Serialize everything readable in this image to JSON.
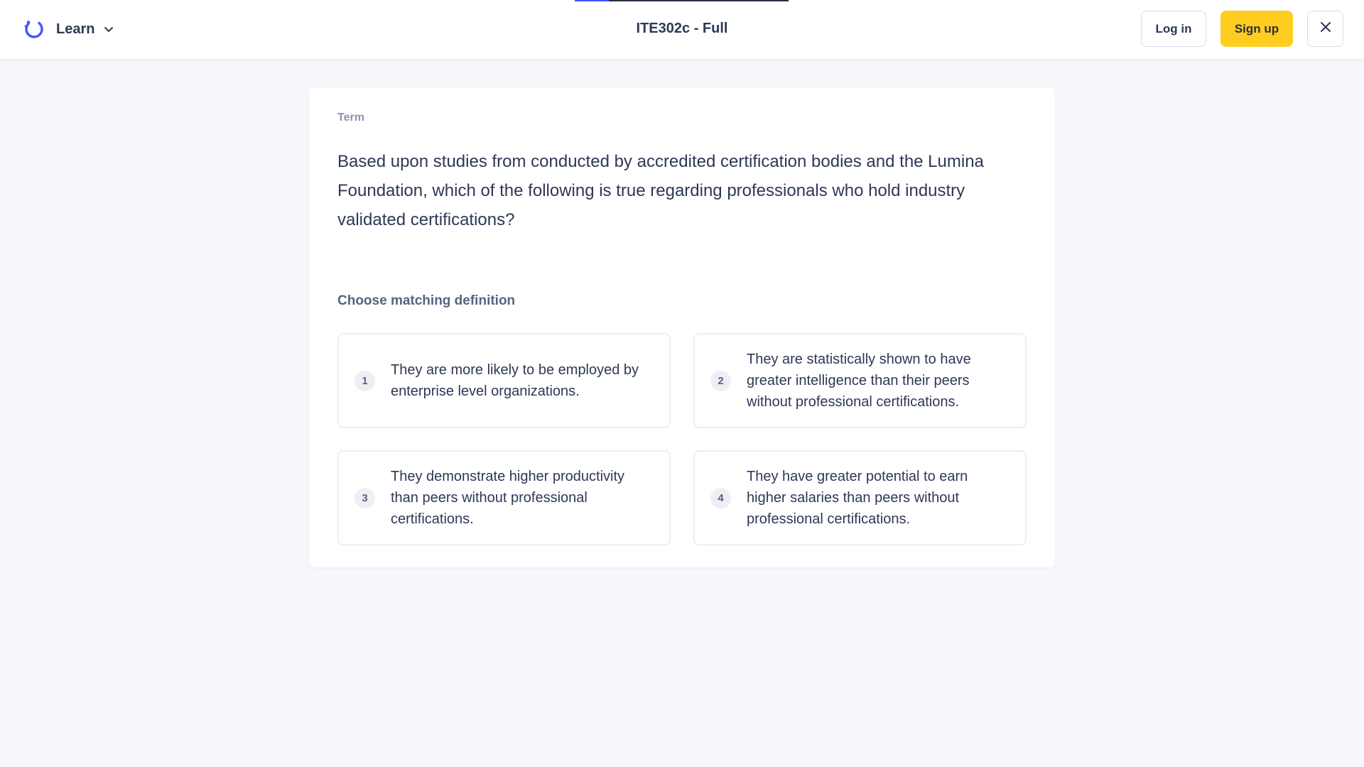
{
  "header": {
    "mode_label": "Learn",
    "set_title": "ITE302c - Full",
    "login_label": "Log in",
    "signup_label": "Sign up",
    "progress_fraction": 0.16,
    "icons": {
      "logo": "quizlet-learn-icon",
      "chevron": "chevron-down-icon",
      "close": "close-icon"
    }
  },
  "card": {
    "term_label": "Term",
    "term_text": "Based upon studies from conducted by accredited certification bodies and the Lumina Foundation, which of the following is true regarding professionals who hold industry validated certifications?",
    "choose_label": "Choose matching definition",
    "options": [
      {
        "number": "1",
        "text": "They are more likely to be employed by enterprise level organizations."
      },
      {
        "number": "2",
        "text": "They are statistically shown to have greater intelligence than their peers without professional certifications."
      },
      {
        "number": "3",
        "text": "They demonstrate higher productivity than peers without professional certifications."
      },
      {
        "number": "4",
        "text": "They have greater potential to earn higher salaries than peers without professional certifications."
      }
    ]
  },
  "colors": {
    "accent": "#4255ff",
    "signup_bg": "#ffcd1f",
    "page_bg": "#f6f7fb",
    "text": "#2e3856"
  }
}
